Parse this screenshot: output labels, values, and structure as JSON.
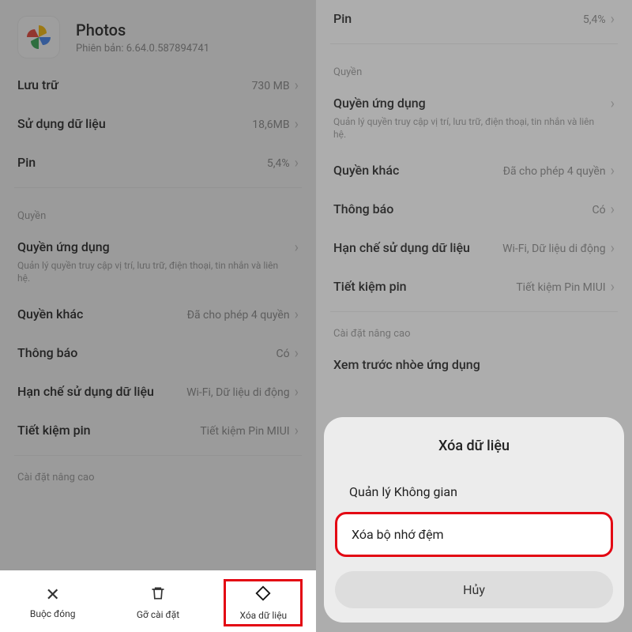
{
  "left": {
    "app": {
      "name": "Photos",
      "version": "Phiên bản: 6.64.0.587894741"
    },
    "rows": {
      "storage": {
        "label": "Lưu trữ",
        "value": "730 MB"
      },
      "data": {
        "label": "Sử dụng dữ liệu",
        "value": "18,6MB"
      },
      "pin": {
        "label": "Pin",
        "value": "5,4%"
      }
    },
    "perm_section": "Quyền",
    "perm_app": {
      "label": "Quyền ứng dụng",
      "note": "Quản lý quyền truy cập vị trí, lưu trữ, điện thoại, tin nhắn và liên hệ."
    },
    "perm_other": {
      "label": "Quyền khác",
      "value": "Đã cho phép 4 quyền"
    },
    "notify": {
      "label": "Thông báo",
      "value": "Có"
    },
    "datalimit": {
      "label": "Hạn chế sử dụng dữ liệu",
      "value": "Wi-Fi, Dữ liệu di động"
    },
    "battery_saver": {
      "label": "Tiết kiệm pin",
      "value": "Tiết kiệm Pin MIUI"
    },
    "advanced": "Cài đặt nâng cao",
    "bottombar": {
      "force": "Buộc đóng",
      "uninstall": "Gỡ cài đặt",
      "clear": "Xóa dữ liệu"
    }
  },
  "right": {
    "pin": {
      "label": "Pin",
      "value": "5,4%"
    },
    "perm_section": "Quyền",
    "perm_app": {
      "label": "Quyền ứng dụng",
      "note": "Quản lý quyền truy cập vị trí, lưu trữ, điện thoại, tin nhắn và liên hệ."
    },
    "perm_other": {
      "label": "Quyền khác",
      "value": "Đã cho phép 4 quyền"
    },
    "notify": {
      "label": "Thông báo",
      "value": "Có"
    },
    "datalimit": {
      "label": "Hạn chế sử dụng dữ liệu",
      "value": "Wi-Fi, Dữ liệu di động"
    },
    "battery_saver": {
      "label": "Tiết kiệm pin",
      "value": "Tiết kiệm Pin MIUI"
    },
    "advanced": "Cài đặt nâng cao",
    "blur_preview": "Xem trước nhòe ứng dụng",
    "sheet": {
      "title": "Xóa dữ liệu",
      "manage": "Quản lý Không gian",
      "cache": "Xóa bộ nhớ đệm",
      "cancel": "Hủy"
    }
  }
}
